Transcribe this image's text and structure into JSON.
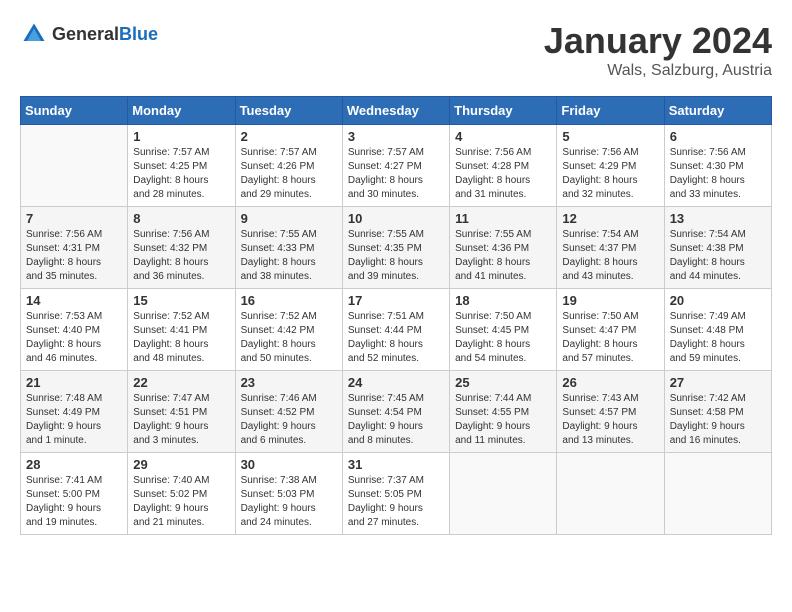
{
  "header": {
    "logo_general": "General",
    "logo_blue": "Blue",
    "month_title": "January 2024",
    "location": "Wals, Salzburg, Austria"
  },
  "days_of_week": [
    "Sunday",
    "Monday",
    "Tuesday",
    "Wednesday",
    "Thursday",
    "Friday",
    "Saturday"
  ],
  "weeks": [
    [
      {
        "day": "",
        "info": ""
      },
      {
        "day": "1",
        "info": "Sunrise: 7:57 AM\nSunset: 4:25 PM\nDaylight: 8 hours\nand 28 minutes."
      },
      {
        "day": "2",
        "info": "Sunrise: 7:57 AM\nSunset: 4:26 PM\nDaylight: 8 hours\nand 29 minutes."
      },
      {
        "day": "3",
        "info": "Sunrise: 7:57 AM\nSunset: 4:27 PM\nDaylight: 8 hours\nand 30 minutes."
      },
      {
        "day": "4",
        "info": "Sunrise: 7:56 AM\nSunset: 4:28 PM\nDaylight: 8 hours\nand 31 minutes."
      },
      {
        "day": "5",
        "info": "Sunrise: 7:56 AM\nSunset: 4:29 PM\nDaylight: 8 hours\nand 32 minutes."
      },
      {
        "day": "6",
        "info": "Sunrise: 7:56 AM\nSunset: 4:30 PM\nDaylight: 8 hours\nand 33 minutes."
      }
    ],
    [
      {
        "day": "7",
        "info": "Sunrise: 7:56 AM\nSunset: 4:31 PM\nDaylight: 8 hours\nand 35 minutes."
      },
      {
        "day": "8",
        "info": "Sunrise: 7:56 AM\nSunset: 4:32 PM\nDaylight: 8 hours\nand 36 minutes."
      },
      {
        "day": "9",
        "info": "Sunrise: 7:55 AM\nSunset: 4:33 PM\nDaylight: 8 hours\nand 38 minutes."
      },
      {
        "day": "10",
        "info": "Sunrise: 7:55 AM\nSunset: 4:35 PM\nDaylight: 8 hours\nand 39 minutes."
      },
      {
        "day": "11",
        "info": "Sunrise: 7:55 AM\nSunset: 4:36 PM\nDaylight: 8 hours\nand 41 minutes."
      },
      {
        "day": "12",
        "info": "Sunrise: 7:54 AM\nSunset: 4:37 PM\nDaylight: 8 hours\nand 43 minutes."
      },
      {
        "day": "13",
        "info": "Sunrise: 7:54 AM\nSunset: 4:38 PM\nDaylight: 8 hours\nand 44 minutes."
      }
    ],
    [
      {
        "day": "14",
        "info": "Sunrise: 7:53 AM\nSunset: 4:40 PM\nDaylight: 8 hours\nand 46 minutes."
      },
      {
        "day": "15",
        "info": "Sunrise: 7:52 AM\nSunset: 4:41 PM\nDaylight: 8 hours\nand 48 minutes."
      },
      {
        "day": "16",
        "info": "Sunrise: 7:52 AM\nSunset: 4:42 PM\nDaylight: 8 hours\nand 50 minutes."
      },
      {
        "day": "17",
        "info": "Sunrise: 7:51 AM\nSunset: 4:44 PM\nDaylight: 8 hours\nand 52 minutes."
      },
      {
        "day": "18",
        "info": "Sunrise: 7:50 AM\nSunset: 4:45 PM\nDaylight: 8 hours\nand 54 minutes."
      },
      {
        "day": "19",
        "info": "Sunrise: 7:50 AM\nSunset: 4:47 PM\nDaylight: 8 hours\nand 57 minutes."
      },
      {
        "day": "20",
        "info": "Sunrise: 7:49 AM\nSunset: 4:48 PM\nDaylight: 8 hours\nand 59 minutes."
      }
    ],
    [
      {
        "day": "21",
        "info": "Sunrise: 7:48 AM\nSunset: 4:49 PM\nDaylight: 9 hours\nand 1 minute."
      },
      {
        "day": "22",
        "info": "Sunrise: 7:47 AM\nSunset: 4:51 PM\nDaylight: 9 hours\nand 3 minutes."
      },
      {
        "day": "23",
        "info": "Sunrise: 7:46 AM\nSunset: 4:52 PM\nDaylight: 9 hours\nand 6 minutes."
      },
      {
        "day": "24",
        "info": "Sunrise: 7:45 AM\nSunset: 4:54 PM\nDaylight: 9 hours\nand 8 minutes."
      },
      {
        "day": "25",
        "info": "Sunrise: 7:44 AM\nSunset: 4:55 PM\nDaylight: 9 hours\nand 11 minutes."
      },
      {
        "day": "26",
        "info": "Sunrise: 7:43 AM\nSunset: 4:57 PM\nDaylight: 9 hours\nand 13 minutes."
      },
      {
        "day": "27",
        "info": "Sunrise: 7:42 AM\nSunset: 4:58 PM\nDaylight: 9 hours\nand 16 minutes."
      }
    ],
    [
      {
        "day": "28",
        "info": "Sunrise: 7:41 AM\nSunset: 5:00 PM\nDaylight: 9 hours\nand 19 minutes."
      },
      {
        "day": "29",
        "info": "Sunrise: 7:40 AM\nSunset: 5:02 PM\nDaylight: 9 hours\nand 21 minutes."
      },
      {
        "day": "30",
        "info": "Sunrise: 7:38 AM\nSunset: 5:03 PM\nDaylight: 9 hours\nand 24 minutes."
      },
      {
        "day": "31",
        "info": "Sunrise: 7:37 AM\nSunset: 5:05 PM\nDaylight: 9 hours\nand 27 minutes."
      },
      {
        "day": "",
        "info": ""
      },
      {
        "day": "",
        "info": ""
      },
      {
        "day": "",
        "info": ""
      }
    ]
  ]
}
